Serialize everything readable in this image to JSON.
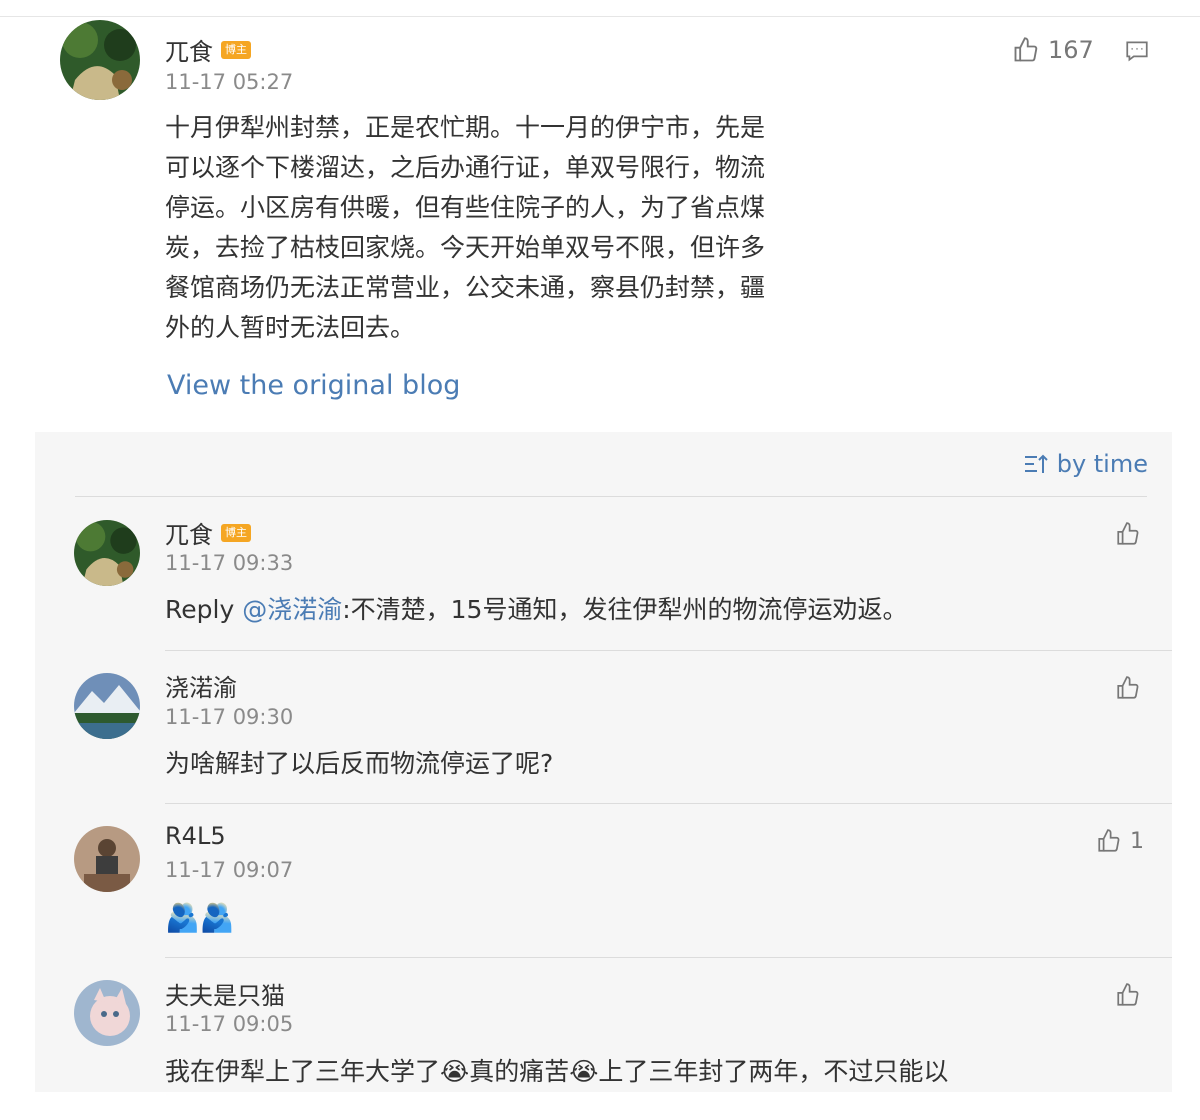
{
  "post": {
    "author": "兀食",
    "badge": "博主",
    "time": "11-17 05:27",
    "likes": "167",
    "lines": [
      "十月伊犁州封禁，正是农忙期。十一月的伊宁市，先是",
      "可以逐个下楼溜达，之后办通行证，单双号限行，物流",
      "停运。小区房有供暖，但有些住院子的人，为了省点煤",
      "炭，去捡了枯枝回家烧。今天开始单双号不限，但许多",
      "餐馆商场仍无法正常营业，公交未通，察县仍封禁，疆",
      "外的人暂时无法回去。"
    ],
    "view_original": "View the original blog"
  },
  "sort_label": "by time",
  "comments": [
    {
      "name": "兀食",
      "badge": "博主",
      "time": "11-17 09:33",
      "reply_prefix": "Reply ",
      "mention": "@浇渃渝",
      "text": ":不清楚，15号通知，发往伊犁州的物流停运劝返。",
      "likes": ""
    },
    {
      "name": "浇渃渝",
      "time": "11-17 09:30",
      "text": "为啥解封了以后反而物流停运了呢?",
      "likes": ""
    },
    {
      "name": "R4L5",
      "time": "11-17 09:07",
      "text": "🫂🫂",
      "likes": "1"
    },
    {
      "name": "夫夫是只猫",
      "time": "11-17 09:05",
      "text": "我在伊犁上了三年大学了😭真的痛苦😭上了三年封了两年，不过只能以",
      "likes": ""
    }
  ],
  "colors": {
    "link": "#4b7cb4",
    "badge": "#f5a623",
    "panel": "#f6f6f6"
  }
}
